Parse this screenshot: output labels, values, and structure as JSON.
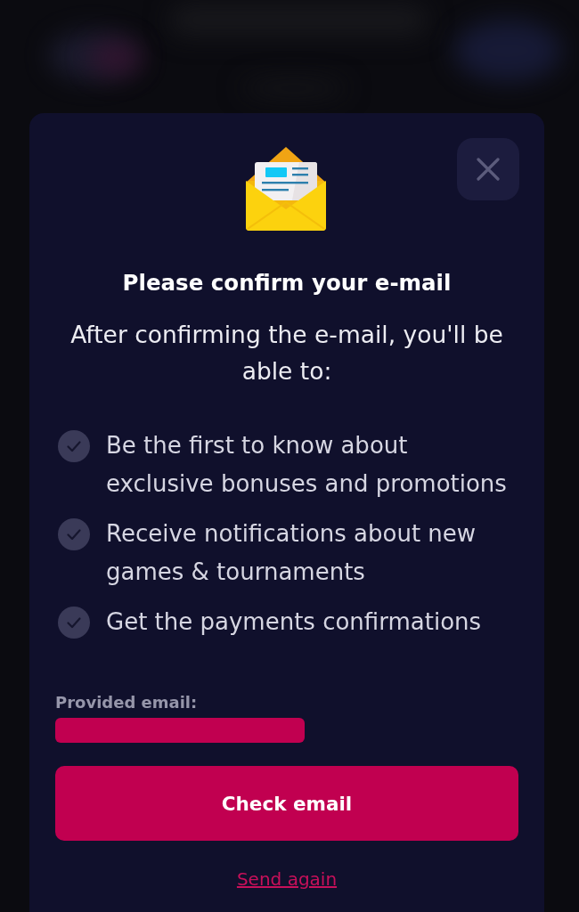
{
  "dialog": {
    "title": "Please confirm your e-mail",
    "subtitle": "After confirming the e-mail, you'll be able to:",
    "benefits": [
      {
        "text": "Be the first to know about exclusive bonuses and promotions"
      },
      {
        "text": "Receive notifications about new games & tournaments"
      },
      {
        "text": "Get the payments confirmations"
      }
    ],
    "email_label": "Provided email:",
    "primary_button": "Check email",
    "secondary_link": "Send again"
  }
}
